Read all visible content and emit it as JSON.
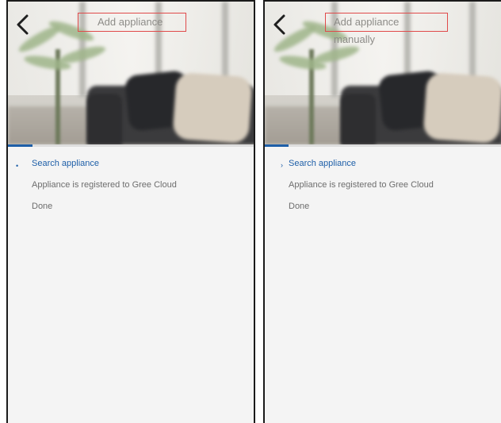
{
  "screens": [
    {
      "title": "Add appliance",
      "steps": [
        {
          "label": "Search appliance",
          "active": true
        },
        {
          "label": "Appliance is registered to Gree Cloud",
          "active": false
        },
        {
          "label": "Done",
          "active": false
        }
      ],
      "progress": 0.1
    },
    {
      "title": "Add appliance manually",
      "steps": [
        {
          "label": "Search appliance",
          "active": true
        },
        {
          "label": "Appliance is registered to Gree Cloud",
          "active": false
        },
        {
          "label": "Done",
          "active": false
        }
      ],
      "progress": 0.1
    }
  ],
  "icons": {
    "back": "chevron-left-icon",
    "step_marker": "bullet-icon"
  },
  "colors": {
    "accent": "#1e5fa8",
    "highlight_box": "#e04a4a",
    "text_secondary": "#6d6d6d"
  }
}
